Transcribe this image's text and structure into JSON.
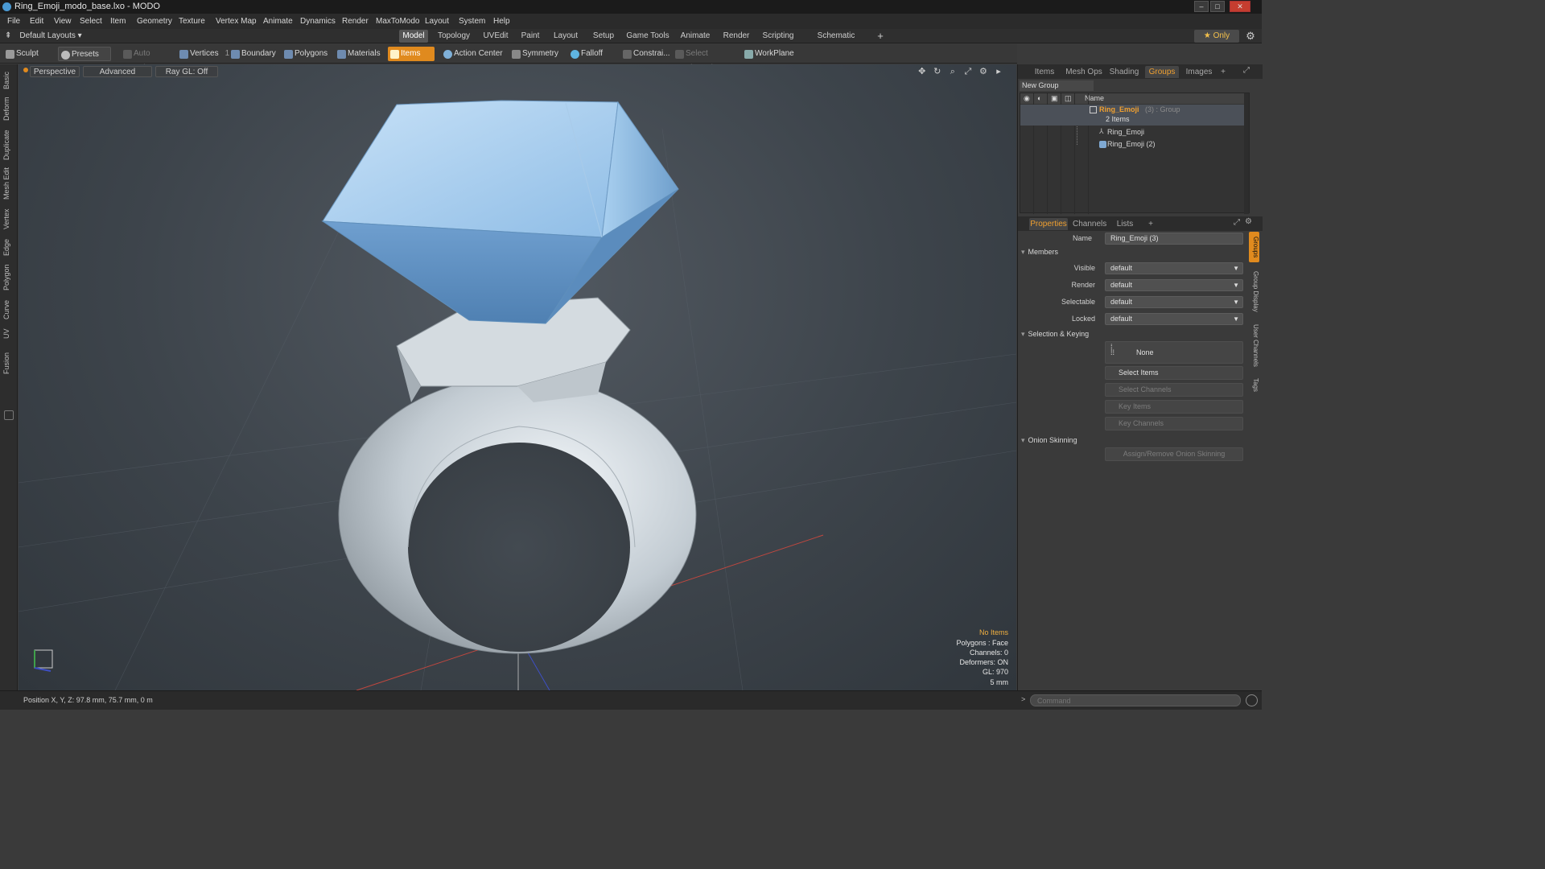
{
  "window": {
    "title": "Ring_Emoji_modo_base.lxo - MODO"
  },
  "menu": [
    "File",
    "Edit",
    "View",
    "Select",
    "Item",
    "Geometry",
    "Texture",
    "Vertex Map",
    "Animate",
    "Dynamics",
    "Render",
    "MaxToModo",
    "Layout",
    "System",
    "Help"
  ],
  "layoutbar": {
    "default_layouts": "Default Layouts ▾",
    "tabs": [
      "Model",
      "Topology",
      "UVEdit",
      "Paint",
      "Layout",
      "Setup",
      "Game Tools",
      "Animate",
      "Render",
      "Scripting",
      "Schematic Fusion"
    ],
    "active_tab": "Model",
    "add": "+",
    "only_label": "★ Only"
  },
  "toolbar": {
    "sculpt": "Sculpt",
    "presets": "Presets",
    "auto_select": "Auto Select",
    "vertices": "Vertices",
    "vertices_count": "1",
    "boundary": "Boundary",
    "polygons": "Polygons",
    "materials": "Materials",
    "items": "Items",
    "action_center": "Action Center",
    "symmetry": "Symmetry",
    "falloff": "Falloff",
    "constraints": "Constrai...",
    "select_through": "Select Through",
    "workplane": "WorkPlane"
  },
  "left_tabs": [
    "Basic",
    "Deform",
    "Duplicate",
    "Mesh Edit",
    "Vertex",
    "Edge",
    "Polygon",
    "Curve",
    "UV",
    "Fusion"
  ],
  "viewport": {
    "view_mode": "Perspective",
    "advanced": "Advanced",
    "raygl": "Ray GL: Off",
    "info": {
      "selection": "No Items",
      "polygons": "Polygons : Face",
      "channels": "Channels: 0",
      "deformers": "Deformers: ON",
      "gl": "GL: 970",
      "grid": "5 mm"
    }
  },
  "status": {
    "position": "Position X, Y, Z:  97.8 mm, 75.7 mm, 0 m"
  },
  "items_panel": {
    "tabs": [
      "Items",
      "Mesh Ops",
      "Shading",
      "Groups",
      "Images"
    ],
    "active_tab": "Groups",
    "add": "+",
    "new_group": "New Group",
    "col_name": "Name",
    "group_name": "Ring_Emoji",
    "group_suffix": "(3) : Group",
    "group_count": "2 Items",
    "children": [
      "Ring_Emoji",
      "Ring_Emoji (2)"
    ]
  },
  "properties_panel": {
    "tabs": [
      "Properties",
      "Channels",
      "Lists"
    ],
    "active_tab": "Properties",
    "add": "+",
    "name_label": "Name",
    "name_value": "Ring_Emoji (3)",
    "members": "Members",
    "visible_label": "Visible",
    "visible_value": "default",
    "render_label": "Render",
    "render_value": "default",
    "selectable_label": "Selectable",
    "selectable_value": "default",
    "locked_label": "Locked",
    "locked_value": "default",
    "selection_keying": "Selection & Keying",
    "none": "None",
    "select_items": "Select Items",
    "select_channels": "Select Channels",
    "key_items": "Key Items",
    "key_channels": "Key Channels",
    "onion_skinning": "Onion Skinning",
    "assign_onion": "Assign/Remove Onion Skinning",
    "side_tabs": [
      "Groups",
      "Group Display",
      "User Channels",
      "Tags"
    ]
  },
  "command": {
    "placeholder": "Command"
  },
  "colors": {
    "accent": "#e08a1e",
    "gem": "#7fb4e6",
    "ring": "#c9d3da"
  }
}
